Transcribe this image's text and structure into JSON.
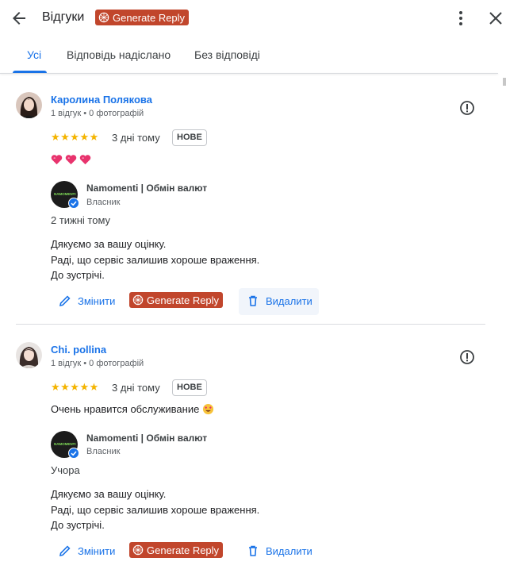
{
  "header": {
    "title": "Відгуки",
    "generate_reply": "Generate Reply"
  },
  "tabs": [
    {
      "label": "Усі",
      "active": true
    },
    {
      "label": "Відповідь надіслано",
      "active": false
    },
    {
      "label": "Без відповіді",
      "active": false
    }
  ],
  "reviews": [
    {
      "name": "Каролина Полякова",
      "meta": "1 відгук • 0 фотографій",
      "rating": 5,
      "stars": "★★★★★",
      "ago": "3 дні тому",
      "badge": "НОВЕ",
      "text": "",
      "emoji": "heart-icon ×3",
      "reply": {
        "owner_name": "Namomenti | Обмін валют",
        "owner_role": "Власник",
        "owner_logo": "NAMOMENTI",
        "ago": "2 тижні тому",
        "lines": [
          "Дякуємо за вашу оцінку.",
          "Раді, що сервіс залишив хороше враження.",
          "До зустрічі."
        ]
      },
      "actions": {
        "edit": "Змінити",
        "generate": "Generate Reply",
        "delete": "Видалити"
      }
    },
    {
      "name": "Chi. pollina",
      "meta": "1 відгук • 0 фотографій",
      "rating": 5,
      "stars": "★★★★★",
      "ago": "3 дні тому",
      "badge": "НОВЕ",
      "text": "Очень нравится обслуживание",
      "emoji": "heart-eyes-icon",
      "reply": {
        "owner_name": "Namomenti | Обмін валют",
        "owner_role": "Власник",
        "owner_logo": "NAMOMENTI",
        "ago": "Учора",
        "lines": [
          "Дякуємо за вашу оцінку.",
          "Раді, що сервіс залишив хороше враження.",
          "До зустрічі."
        ]
      },
      "actions": {
        "edit": "Змінити",
        "generate": "Generate Reply",
        "delete": "Видалити"
      }
    }
  ],
  "colors": {
    "accent": "#1a73e8",
    "generate_button": "#c1462c",
    "stars": "#f4b400",
    "heart": "#e8336d"
  }
}
